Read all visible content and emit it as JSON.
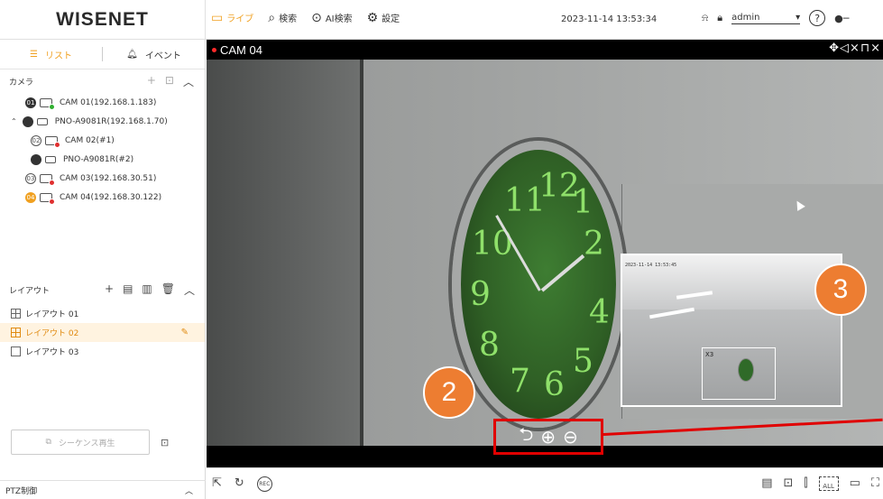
{
  "header": {
    "logo": "WISENET",
    "nav": [
      {
        "label": "ライブ",
        "icon": "monitor-icon",
        "active": true
      },
      {
        "label": "検索",
        "icon": "search-icon",
        "active": false
      },
      {
        "label": "AI検索",
        "icon": "ai-search-icon",
        "active": false
      },
      {
        "label": "設定",
        "icon": "gear-icon",
        "active": false
      }
    ],
    "datetime": "2023-11-14 13:53:34",
    "user": "admin"
  },
  "sidebar": {
    "tabs": [
      {
        "label": "リスト",
        "active": true
      },
      {
        "label": "イベント",
        "active": false
      }
    ],
    "camera_section_label": "カメラ",
    "cameras": [
      {
        "badge": "01",
        "label": "CAM 01(192.168.1.183)",
        "level": 0
      },
      {
        "badge": "",
        "label": "PNO-A9081R(192.168.1.70)",
        "level": 0,
        "expand": "^"
      },
      {
        "badge": "02",
        "label": "CAM 02(#1)",
        "level": 1
      },
      {
        "badge": "",
        "label": "PNO-A9081R(#2)",
        "level": 1
      },
      {
        "badge": "03",
        "label": "CAM 03(192.168.30.51)",
        "level": 0
      },
      {
        "badge": "04",
        "label": "CAM 04(192.168.30.122)",
        "level": 0
      }
    ],
    "layout_section_label": "レイアウト",
    "layouts": [
      {
        "label": "レイアウト 01",
        "selected": false
      },
      {
        "label": "レイアウト 02",
        "selected": true
      },
      {
        "label": "レイアウト 03",
        "selected": false
      }
    ],
    "sequence_button": "シーケンス再生",
    "ptz_label": "PTZ制御"
  },
  "video": {
    "camera_title": "CAM 04",
    "minimap_timestamp": "2023-11-14 13:53:45",
    "minimap_zoom": "X3",
    "clock_numbers": [
      "11",
      "12",
      "1",
      "2",
      "10",
      "9",
      "8",
      "7",
      "6",
      "5",
      "4"
    ],
    "callouts": [
      "2",
      "3"
    ],
    "zoom_controls": [
      "back-icon",
      "zoom-in-icon",
      "zoom-out-icon"
    ]
  },
  "footer": {
    "rec_label": "REC",
    "all_label": "ALL"
  }
}
